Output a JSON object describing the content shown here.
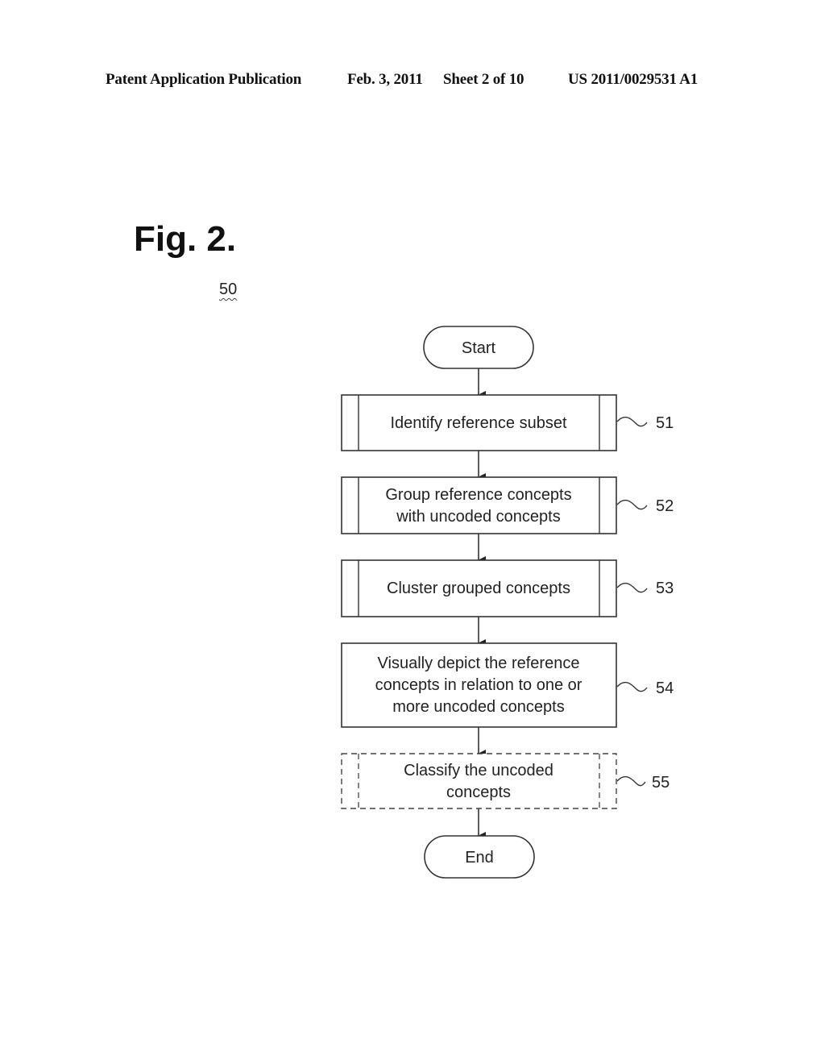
{
  "header": {
    "publication": "Patent Application Publication",
    "date": "Feb. 3, 2011",
    "sheet": "Sheet 2 of 10",
    "number": "US 2011/0029531 A1"
  },
  "figure": {
    "title": "Fig. 2.",
    "reference": "50"
  },
  "flowchart": {
    "start": "Start",
    "end": "End",
    "steps": [
      {
        "ref": "51",
        "type": "predefined-process",
        "lines": [
          "Identify reference subset"
        ]
      },
      {
        "ref": "52",
        "type": "predefined-process",
        "lines": [
          "Group reference concepts",
          "with uncoded concepts"
        ]
      },
      {
        "ref": "53",
        "type": "predefined-process",
        "lines": [
          "Cluster grouped concepts"
        ]
      },
      {
        "ref": "54",
        "type": "process",
        "lines": [
          "Visually depict the reference",
          "concepts in relation to one or",
          "more uncoded concepts"
        ]
      },
      {
        "ref": "55",
        "type": "optional-predefined-process",
        "lines": [
          "Classify the uncoded",
          "concepts"
        ]
      }
    ]
  }
}
